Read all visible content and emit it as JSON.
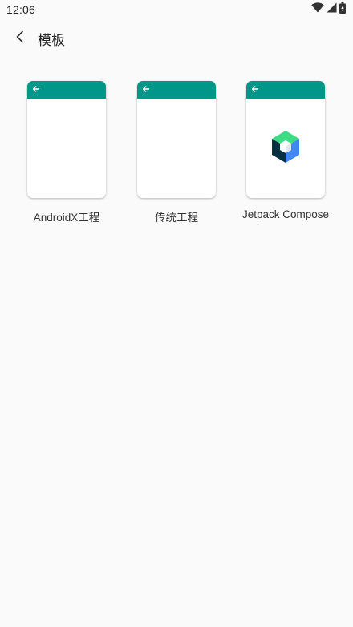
{
  "status_bar": {
    "time": "12:06",
    "icons": [
      "wifi-icon",
      "signal-icon",
      "battery-icon"
    ]
  },
  "app_bar": {
    "back_icon": "back-arrow-icon",
    "title": "模板"
  },
  "templates": [
    {
      "label": "AndroidX工程",
      "header_icon": "back-arrow-icon",
      "body_icon": null
    },
    {
      "label": "传统工程",
      "header_icon": "back-arrow-icon",
      "body_icon": null
    },
    {
      "label": "Jetpack Compose",
      "header_icon": "back-arrow-icon",
      "body_icon": "jetpack-compose-logo-icon"
    }
  ],
  "colors": {
    "background": "#fafafa",
    "template_header": "#009688",
    "card": "#ffffff",
    "text": "#222222",
    "compose_green": "#3ddc84",
    "compose_blue": "#4285f4",
    "compose_dark": "#073042"
  }
}
